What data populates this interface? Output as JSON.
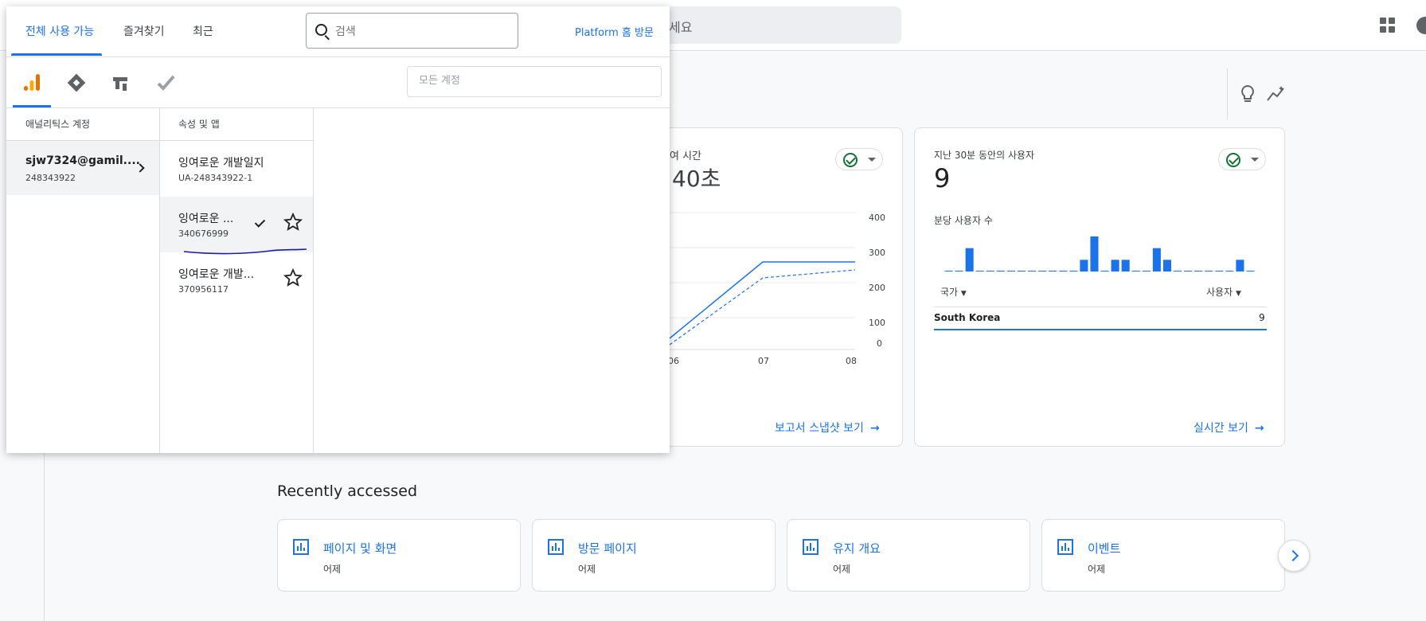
{
  "topbar": {
    "search_placeholder_tail": "세요"
  },
  "popup": {
    "tabs": [
      {
        "label": "전체 사용 가능",
        "active": true
      },
      {
        "label": "즐겨찾기",
        "active": false
      },
      {
        "label": "최근",
        "active": false
      }
    ],
    "search": {
      "value": "",
      "placeholder": "검색"
    },
    "platform_link": "Platform 홈 방문",
    "products": [
      "analytics-icon",
      "tag-manager-icon",
      "optimize-icon",
      "surveys-icon"
    ],
    "account_filter_placeholder": "모든 계정",
    "columns": {
      "accounts_header": "애널리틱스 계정",
      "properties_header": "속성 및 앱"
    },
    "accounts": [
      {
        "name": "sjw7324@gamil....",
        "id": "248343922"
      }
    ],
    "properties": [
      {
        "name": "잉여로운 개발일지",
        "id": "UA-248343922-1",
        "selected": false
      },
      {
        "name": "잉여로운 ...",
        "id": "340676999",
        "selected": true
      },
      {
        "name": "잉여로운 개발...",
        "id": "370956117",
        "selected": false
      }
    ]
  },
  "engagement_card": {
    "title_partial": "여 시간",
    "value_partial": "40초",
    "y_ticks": [
      "400",
      "300",
      "200",
      "100",
      "0"
    ],
    "x_ticks": [
      "06",
      "07",
      "08"
    ],
    "link": "보고서 스냅샷 보기"
  },
  "realtime_card": {
    "title": "지난 30분 동안의 사용자",
    "value": "9",
    "subtitle": "분당 사용자 수",
    "col_country": "국가",
    "col_users": "사용자",
    "row_country": "South Korea",
    "row_users": "9",
    "link": "실시간 보기"
  },
  "recent": {
    "heading": "Recently accessed",
    "items": [
      {
        "title": "페이지 및 화면",
        "sub": "어제"
      },
      {
        "title": "방문 페이지",
        "sub": "어제"
      },
      {
        "title": "유지 개요",
        "sub": "어제"
      },
      {
        "title": "이벤트",
        "sub": "어제"
      }
    ]
  },
  "colors": {
    "accent": "#1a73e8",
    "success": "#137333",
    "analytics_orange": "#f9ab00",
    "analytics_dark_orange": "#e37400",
    "ink_blue": "#1a1aa6"
  },
  "chart_data": {
    "type": "bar",
    "title": "분당 사용자 수",
    "values": [
      0,
      0,
      2,
      0,
      0,
      0,
      0,
      0,
      0,
      0,
      0,
      0,
      0,
      1,
      3,
      0,
      1,
      1,
      0,
      0,
      2,
      1,
      0,
      0,
      0,
      0,
      0,
      0,
      1,
      0
    ]
  }
}
